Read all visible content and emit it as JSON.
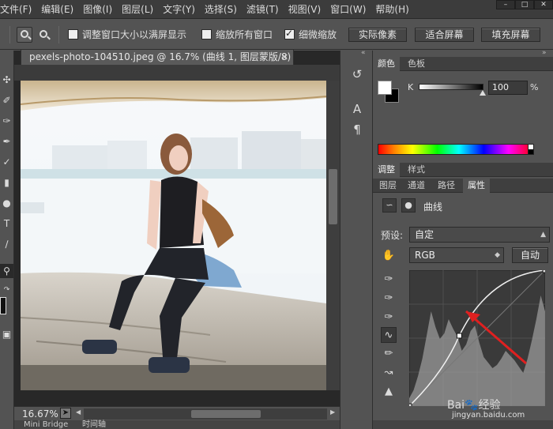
{
  "menu": {
    "items": [
      "文件(F)",
      "编辑(E)",
      "图像(I)",
      "图层(L)",
      "文字(Y)",
      "选择(S)",
      "滤镜(T)",
      "视图(V)",
      "窗口(W)",
      "帮助(H)"
    ],
    "window_controls": [
      "minimize",
      "restore",
      "close"
    ]
  },
  "options": {
    "resize_windows_label": "调整窗口大小以满屏显示",
    "resize_windows_checked": false,
    "zoom_all_label": "缩放所有窗口",
    "zoom_all_checked": false,
    "scrubby_zoom_label": "细微缩放",
    "scrubby_zoom_checked": true,
    "actual_pixels_label": "实际像素",
    "fit_screen_label": "适合屏幕",
    "fill_screen_label": "填充屏幕"
  },
  "document": {
    "tab_title": "pexels-photo-104510.jpeg @ 16.7% (曲线 1, 图层蒙版/8) *",
    "zoom_level": "16.67%"
  },
  "bottom_tabs": [
    "Mini Bridge",
    "时间轴"
  ],
  "color_panel": {
    "tabs": [
      "颜色",
      "色板"
    ],
    "channel_label": "K",
    "k_value": "100",
    "k_percent": "%",
    "k_level": 1.0
  },
  "adjust_panel": {
    "tabs": [
      "调整",
      "样式"
    ]
  },
  "props_panel": {
    "tabs": [
      "图层",
      "通道",
      "路径",
      "属性"
    ],
    "title": "曲线",
    "preset_label": "预设:",
    "preset_value": "自定",
    "channel_value": "RGB",
    "auto_label": "自动"
  },
  "curve": {
    "points": [
      [
        0,
        0
      ],
      [
        94,
        132
      ],
      [
        255,
        255
      ]
    ]
  },
  "watermark": {
    "brand": "Bai",
    "brand_cn": "经验",
    "url": "jingyan.baidu.com"
  },
  "colors": {
    "ui_dark": "#535353",
    "annotation_arrow": "#e02020"
  }
}
